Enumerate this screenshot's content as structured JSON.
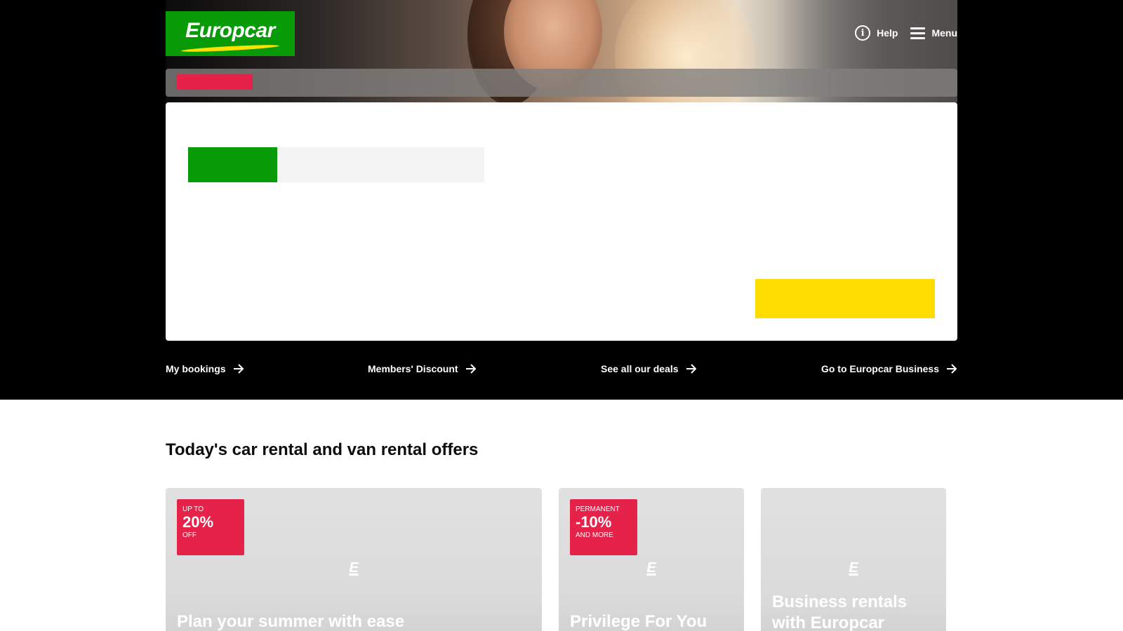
{
  "brand": {
    "name": "Europcar",
    "logo_color": "#089b07",
    "accent": "#ffe100"
  },
  "top_nav": {
    "help": {
      "label": "Help",
      "icon": "info-icon"
    },
    "menu": {
      "label": "Menu",
      "icon": "hamburger-icon"
    }
  },
  "colors": {
    "promo_red": "#e4224a",
    "search_yellow": "#ffdd00",
    "hero_bg": "#000000"
  },
  "quick_links": [
    {
      "label": "My bookings",
      "icon": "arrow-right-icon"
    },
    {
      "label": "Members' Discount",
      "icon": "arrow-right-icon"
    },
    {
      "label": "See all our deals",
      "icon": "arrow-right-icon"
    },
    {
      "label": "Go to Europcar Business",
      "icon": "arrow-right-icon"
    }
  ],
  "offers": {
    "title": "Today's car rental and van rental offers",
    "cards": [
      {
        "badge_top": "UP TO",
        "badge_value": "20%",
        "badge_bottom": "OFF",
        "title": "Plan your summer with ease",
        "logo": "E"
      },
      {
        "badge_top": "PERMANENT",
        "badge_value": "-10%",
        "badge_bottom": "AND MORE",
        "title": "Privilege For You",
        "logo": "E"
      },
      {
        "title": "Business rentals with Europcar",
        "logo": "E"
      }
    ]
  }
}
